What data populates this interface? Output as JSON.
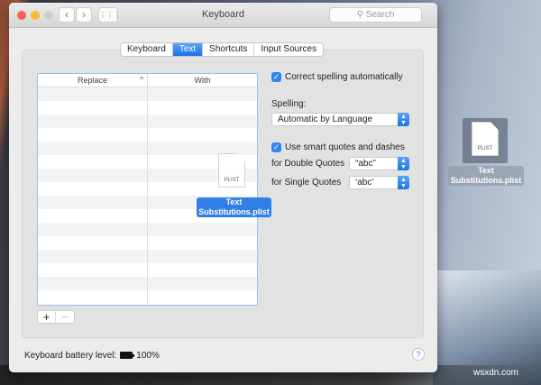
{
  "window": {
    "title": "Keyboard",
    "search_placeholder": "Search",
    "back": "‹",
    "forward": "›",
    "grid": "⋮⋮⋮"
  },
  "tabs": [
    {
      "label": "Keyboard"
    },
    {
      "label": "Text",
      "active": true
    },
    {
      "label": "Shortcuts"
    },
    {
      "label": "Input Sources"
    }
  ],
  "table": {
    "columns": [
      "Replace",
      "With"
    ],
    "sort_indicator": "^"
  },
  "buttons": {
    "add": "+",
    "remove": "−",
    "help": "?"
  },
  "settings": {
    "correct_spelling": {
      "label": "Correct spelling automatically",
      "checked": true
    },
    "spelling_label": "Spelling:",
    "spelling_value": "Automatic by Language",
    "smart_quotes": {
      "label": "Use smart quotes and dashes",
      "checked": true
    },
    "double_label": "for Double Quotes",
    "double_value": "“abc”",
    "single_label": "for Single Quotes",
    "single_value": "‘abc’"
  },
  "footer": {
    "battery_label": "Keyboard battery level:",
    "battery_value": "100%"
  },
  "drag_file": {
    "type": "PLIST",
    "name_line1": "Text",
    "name_line2": "Substitutions.plist"
  },
  "desktop_file": {
    "type": "PLIST",
    "name_line1": "Text",
    "name_line2": "Substitutions.plist"
  },
  "watermark": "wsxdn.com"
}
